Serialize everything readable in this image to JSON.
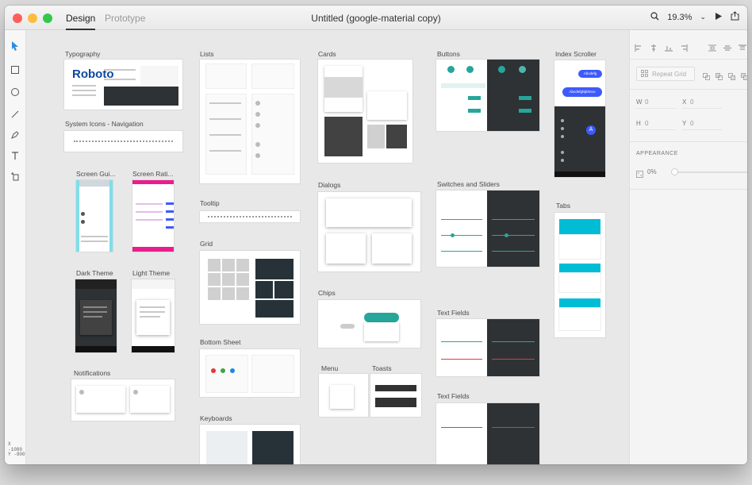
{
  "window": {
    "tabs": [
      "Design",
      "Prototype"
    ],
    "title": "Untitled (google-material copy)",
    "zoom": "19.3%"
  },
  "toolbar": {
    "tools": [
      "select-arrow-icon",
      "rectangle-icon",
      "ellipse-icon",
      "line-icon",
      "pen-icon",
      "text-icon",
      "artboard-icon"
    ],
    "coords": {
      "x_label": "X",
      "x_value": "-1080",
      "y_label": "Y",
      "y_value": "-800"
    }
  },
  "canvas": {
    "artboards": {
      "typography": "Typography",
      "system_icons": "System Icons - Navigation",
      "screen_gui": "Screen Gui...",
      "screen_rati": "Screen Rati...",
      "dark_theme": "Dark Theme",
      "light_theme": "Light Theme",
      "notifications": "Notifications",
      "lists": "Lists",
      "tooltip": "Tooltip",
      "grid": "Grid",
      "bottom_sheet": "Bottom Sheet",
      "keyboards": "Keyboards",
      "cards": "Cards",
      "dialogs": "Dialogs",
      "chips": "Chips",
      "menu": "Menu",
      "toasts": "Toasts",
      "buttons": "Buttons",
      "switches": "Switches and Sliders",
      "text_fields_1": "Text Fields",
      "text_fields_2": "Text Fields",
      "index_scroller": "Index Scroller",
      "tabs": "Tabs"
    },
    "typography_sample": "Roboto",
    "index_chip_1": "Abcdefg",
    "index_chip_2": "Abcdefghijklmno",
    "index_avatar": "A"
  },
  "properties": {
    "repeat_grid": "Repeat Grid",
    "w_label": "W",
    "w_value": "0",
    "x_label": "X",
    "x_value": "0",
    "h_label": "H",
    "h_value": "0",
    "y_label": "Y",
    "y_value": "0",
    "appearance_label": "APPEARANCE",
    "opacity": "0%",
    "opacity_fraction": 0
  },
  "colors": {
    "accent": "#00bcd4",
    "teal": "#26a69a",
    "pink": "#e91e8c",
    "indigo": "#3d5afe",
    "close": "#fc605c",
    "minimize": "#fdbc40",
    "zoom": "#34c84a"
  }
}
